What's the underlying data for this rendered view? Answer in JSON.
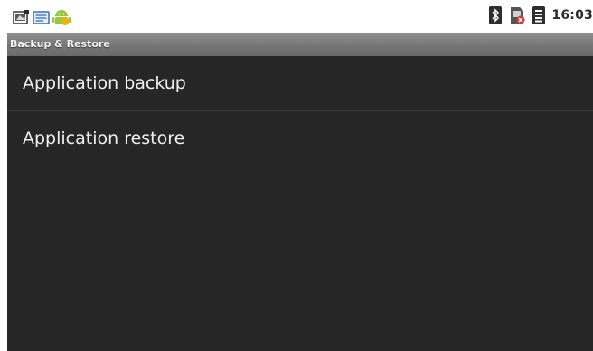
{
  "status_bar": {
    "time": "16:03",
    "left_icons": [
      "screenshot-notification-icon",
      "message-notification-icon",
      "android-robot-icon"
    ],
    "right_icons": [
      "bluetooth-icon",
      "sim-missing-icon",
      "signal-icon"
    ]
  },
  "title_bar": {
    "title": "Backup & Restore"
  },
  "menu": {
    "items": [
      {
        "label": "Application backup"
      },
      {
        "label": "Application restore"
      }
    ]
  },
  "colors": {
    "background": "#262626",
    "title_bar": "#7a7a7a",
    "text": "#f0f0f0",
    "divider": "#3a3a3a"
  }
}
